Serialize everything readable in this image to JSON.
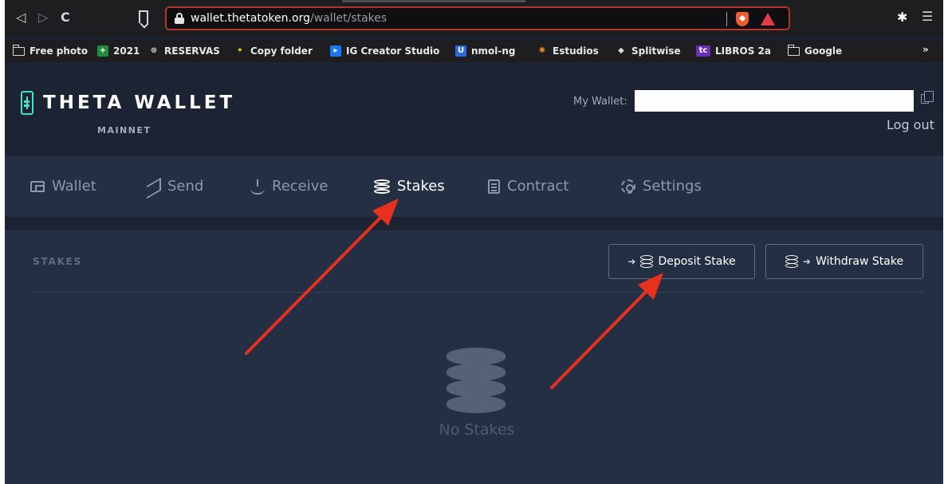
{
  "browser": {
    "url_host": "wallet.thetatoken.org",
    "url_path": "/wallet/stakes",
    "bookmarks": [
      {
        "label": "Free photo",
        "icon": "folder-icon"
      },
      {
        "label": "2021",
        "icon": "spreadsheet-icon",
        "color": "#1e8e3e"
      },
      {
        "label": "RESERVAS",
        "icon": "reservas-icon"
      },
      {
        "label": "Copy folder",
        "icon": "copy-folder-icon"
      },
      {
        "label": "IG Creator Studio",
        "icon": "ig-creator-studio-icon",
        "color": "#1877f2"
      },
      {
        "label": "nmol-ng",
        "icon": "nmol-ng-icon",
        "color": "#2d6ae3"
      },
      {
        "label": "Estudios",
        "icon": "estudios-icon"
      },
      {
        "label": "Splitwise",
        "icon": "splitwise-icon"
      },
      {
        "label": "LIBROS 2a",
        "icon": "tc-icon",
        "color": "#6b2fb5"
      },
      {
        "label": "Google",
        "icon": "folder-icon"
      }
    ],
    "more_label": "»"
  },
  "header": {
    "logo_text": "THETA WALLET",
    "network": "MAINNET",
    "wallet_label": "My Wallet:",
    "logout_label": "Log out",
    "accent_color": "#3ee3c8"
  },
  "nav": {
    "items": [
      {
        "label": "Wallet",
        "icon": "wallet-icon"
      },
      {
        "label": "Send",
        "icon": "send-icon"
      },
      {
        "label": "Receive",
        "icon": "receive-icon"
      },
      {
        "label": "Stakes",
        "icon": "stakes-icon",
        "active": true
      },
      {
        "label": "Contract",
        "icon": "contract-icon"
      },
      {
        "label": "Settings",
        "icon": "settings-icon"
      }
    ]
  },
  "stakes": {
    "section_title": "STAKES",
    "deposit_label": "Deposit Stake",
    "withdraw_label": "Withdraw Stake",
    "empty_message": "No Stakes"
  },
  "annotations": {
    "arrow_color": "#e8301f"
  }
}
